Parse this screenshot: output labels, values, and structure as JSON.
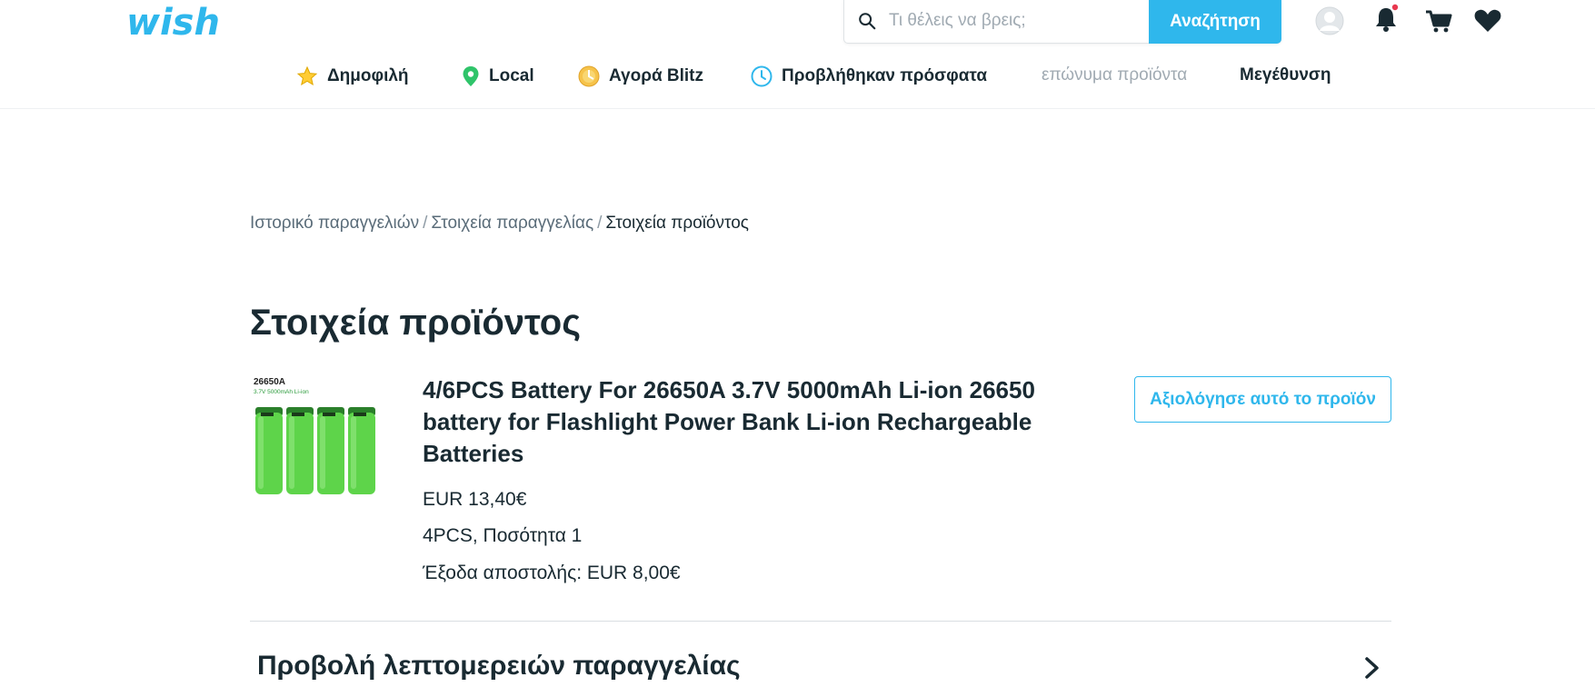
{
  "header": {
    "logo_text": "wish",
    "search": {
      "placeholder": "Τι θέλεις να βρεις;",
      "button_label": "Αναζήτηση"
    },
    "icons": [
      "user-avatar-icon",
      "bell-icon",
      "cart-icon",
      "heart-icon"
    ],
    "notification_dot_color": "#e8384f"
  },
  "nav": {
    "items": [
      {
        "label": "Δημοφιλή",
        "icon": "star-icon"
      },
      {
        "label": "Local",
        "icon": "location-pin-icon"
      },
      {
        "label": "Αγορά Blitz",
        "icon": "blitz-icon"
      },
      {
        "label": "Προβλήθηκαν πρόσφατα",
        "icon": "clock-icon"
      },
      {
        "label": "επώνυμα προϊόντα"
      },
      {
        "label": "Μεγέθυνση"
      }
    ]
  },
  "breadcrumb": {
    "items": [
      "Ιστορικό παραγγελιών",
      "Στοιχεία παραγγελίας",
      "Στοιχεία προϊόντος"
    ],
    "separator": "/"
  },
  "page": {
    "title": "Στοιχεία προϊόντος"
  },
  "product": {
    "image_label": "26650A",
    "image_sublabel": "3.7V 5000mAh Li-ion",
    "title": "4/6PCS Battery For 26650A 3.7V 5000mAh Li-ion 26650 battery for Flashlight Power Bank Li-ion Rechargeable Batteries",
    "price": "EUR 13,40€",
    "variant": "4PCS, Ποσότητα 1",
    "shipping": "Έξοδα αποστολής: EUR 8,00€",
    "rate_button_label": "Αξιολόγησε αυτό το προϊόν"
  },
  "order_details_link": {
    "label": "Προβολή λεπτομερειών παραγγελίας"
  },
  "colors": {
    "accent": "#2fb7ec",
    "text": "#192a32",
    "muted": "#a0aab2",
    "battery_green": "#5ed44a"
  }
}
